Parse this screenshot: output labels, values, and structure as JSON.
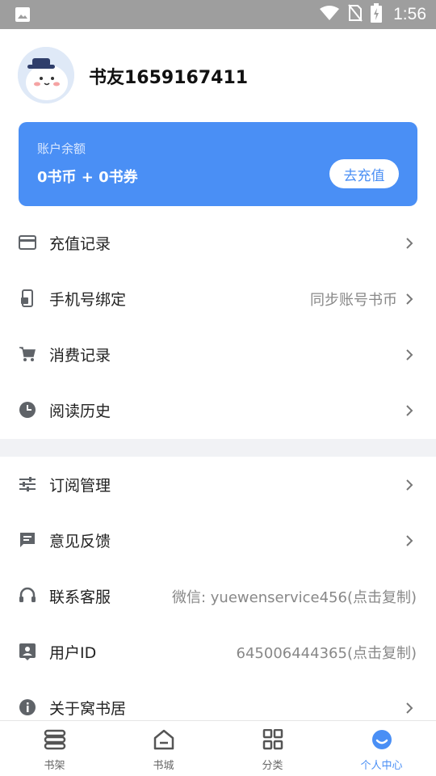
{
  "status_bar": {
    "time": "1:56",
    "icons": [
      "image-icon",
      "wifi-icon",
      "no-sim-icon",
      "battery-charging-icon"
    ]
  },
  "profile": {
    "username": "书友1659167411",
    "avatar_icon": "snowman-avatar"
  },
  "balance": {
    "label": "账户余额",
    "value": "0书币 + 0书券",
    "button_label": "去充值",
    "color": "#4a8ff5"
  },
  "menu_group_1": [
    {
      "label": "充值记录",
      "icon": "credit-card-icon",
      "hint": ""
    },
    {
      "label": "手机号绑定",
      "icon": "phone-lock-icon",
      "hint": "同步账号书币"
    },
    {
      "label": "消费记录",
      "icon": "cart-icon",
      "hint": ""
    },
    {
      "label": "阅读历史",
      "icon": "clock-icon",
      "hint": ""
    }
  ],
  "menu_group_2": [
    {
      "label": "订阅管理",
      "icon": "sliders-icon",
      "hint": ""
    },
    {
      "label": "意见反馈",
      "icon": "feedback-icon",
      "hint": ""
    },
    {
      "label": "联系客服",
      "icon": "headset-icon",
      "hint": "微信: yuewenservice456(点击复制)"
    },
    {
      "label": "用户ID",
      "icon": "user-id-icon",
      "hint": "645006444365(点击复制)"
    },
    {
      "label": "关于窝书居",
      "icon": "info-icon",
      "hint": ""
    }
  ],
  "tabs": [
    {
      "label": "书架",
      "icon": "bookshelf-icon",
      "active": false
    },
    {
      "label": "书城",
      "icon": "home-icon",
      "active": false
    },
    {
      "label": "分类",
      "icon": "grid-icon",
      "active": false
    },
    {
      "label": "个人中心",
      "icon": "smile-icon",
      "active": true
    }
  ],
  "colors": {
    "accent": "#4a8ff5",
    "statusbar": "#9e9e9e",
    "icon_gray": "#5f6368",
    "hint_gray": "#888888",
    "band": "#f1f2f5"
  }
}
